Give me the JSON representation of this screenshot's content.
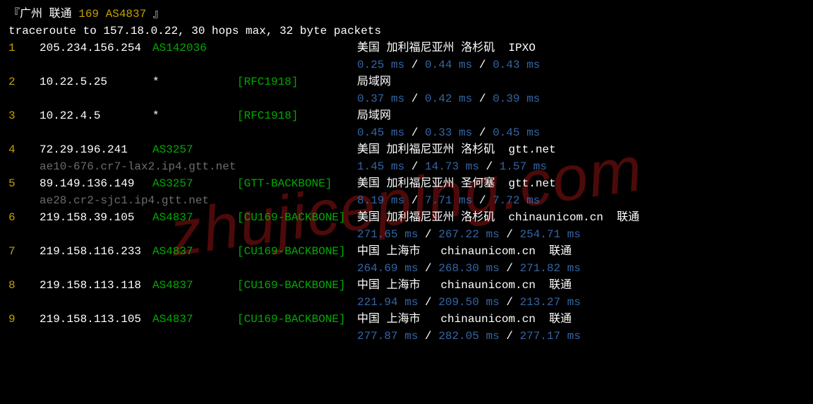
{
  "header": {
    "prefix": "『广州 联通 ",
    "asn": "169 AS4837",
    "suffix": " 』"
  },
  "subheader": "traceroute to 157.18.0.22, 30 hops max, 32 byte packets",
  "watermark": "zhujiceping.com",
  "hops": [
    {
      "num": "1",
      "ip": "205.234.156.254",
      "asn": "AS142036",
      "bracket": "",
      "location": "美国 加利福尼亚州 洛杉矶  IPXO",
      "hostname": "",
      "lat1": "0.25 ms",
      "lat2": "0.44 ms",
      "lat3": "0.43 ms"
    },
    {
      "num": "2",
      "ip": "10.22.5.25",
      "asn": "*",
      "bracket": "[RFC1918]",
      "location": "局域网",
      "hostname": "",
      "lat1": "0.37 ms",
      "lat2": "0.42 ms",
      "lat3": "0.39 ms"
    },
    {
      "num": "3",
      "ip": "10.22.4.5",
      "asn": "*",
      "bracket": "[RFC1918]",
      "location": "局域网",
      "hostname": "",
      "lat1": "0.45 ms",
      "lat2": "0.33 ms",
      "lat3": "0.45 ms"
    },
    {
      "num": "4",
      "ip": "72.29.196.241",
      "asn": "AS3257",
      "bracket": "",
      "location": "美国 加利福尼亚州 洛杉矶  gtt.net",
      "hostname": "ae10-676.cr7-lax2.ip4.gtt.net",
      "lat1": "1.45 ms",
      "lat2": "14.73 ms",
      "lat3": "1.57 ms"
    },
    {
      "num": "5",
      "ip": "89.149.136.149",
      "asn": "AS3257",
      "bracket": "[GTT-BACKBONE]",
      "location": "美国 加利福尼亚州 圣何塞  gtt.net",
      "hostname": "ae28.cr2-sjc1.ip4.gtt.net",
      "lat1": "8.19 ms",
      "lat2": "7.71 ms",
      "lat3": "7.72 ms"
    },
    {
      "num": "6",
      "ip": "219.158.39.105",
      "asn": "AS4837",
      "bracket": "[CU169-BACKBONE]",
      "location": "美国 加利福尼亚州 洛杉矶  chinaunicom.cn  联通",
      "hostname": "",
      "lat1": "271.65 ms",
      "lat2": "267.22 ms",
      "lat3": "254.71 ms"
    },
    {
      "num": "7",
      "ip": "219.158.116.233",
      "asn": "AS4837",
      "bracket": "[CU169-BACKBONE]",
      "location": "中国 上海市   chinaunicom.cn  联通",
      "hostname": "",
      "lat1": "264.69 ms",
      "lat2": "268.30 ms",
      "lat3": "271.82 ms"
    },
    {
      "num": "8",
      "ip": "219.158.113.118",
      "asn": "AS4837",
      "bracket": "[CU169-BACKBONE]",
      "location": "中国 上海市   chinaunicom.cn  联通",
      "hostname": "",
      "lat1": "221.94 ms",
      "lat2": "209.50 ms",
      "lat3": "213.27 ms"
    },
    {
      "num": "9",
      "ip": "219.158.113.105",
      "asn": "AS4837",
      "bracket": "[CU169-BACKBONE]",
      "location": "中国 上海市   chinaunicom.cn  联通",
      "hostname": "",
      "lat1": "277.87 ms",
      "lat2": "282.05 ms",
      "lat3": "277.17 ms"
    }
  ],
  "separator": " / "
}
